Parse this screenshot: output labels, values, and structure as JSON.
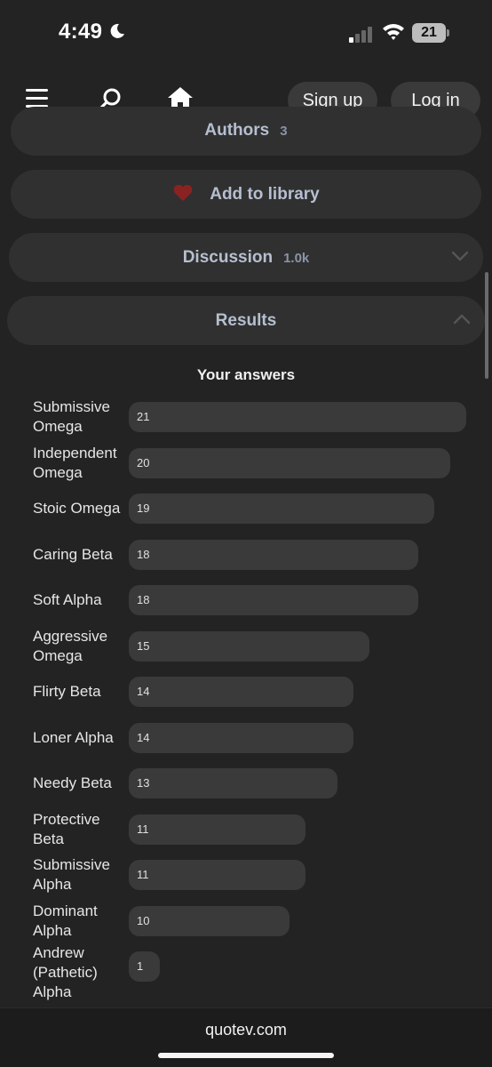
{
  "status_bar": {
    "time": "4:49",
    "battery": "21"
  },
  "nav": {
    "signup_label": "Sign up",
    "login_label": "Log in"
  },
  "sections": {
    "authors": {
      "label": "Authors",
      "count": "3"
    },
    "library": {
      "label": "Add to library"
    },
    "discussion": {
      "label": "Discussion",
      "count": "1.0k"
    },
    "results": {
      "label": "Results"
    }
  },
  "results_heading": "Your answers",
  "answers": [
    {
      "label": "Submissive Omega",
      "value": 21
    },
    {
      "label": "Independent Omega",
      "value": 20
    },
    {
      "label": "Stoic Omega",
      "value": 19
    },
    {
      "label": "Caring Beta",
      "value": 18
    },
    {
      "label": "Soft Alpha",
      "value": 18
    },
    {
      "label": "Aggressive Omega",
      "value": 15
    },
    {
      "label": "Flirty Beta",
      "value": 14
    },
    {
      "label": "Loner Alpha",
      "value": 14
    },
    {
      "label": "Needy Beta",
      "value": 13
    },
    {
      "label": "Protective Beta",
      "value": 11
    },
    {
      "label": "Submissive Alpha",
      "value": 11
    },
    {
      "label": "Dominant Alpha",
      "value": 10
    },
    {
      "label": "Andrew (Pathetic) Alpha",
      "value": 1
    }
  ],
  "footer": {
    "domain": "quotev.com"
  },
  "colors": {
    "background": "#232323",
    "section": "#303030",
    "bar": "#3a3a3a",
    "heart": "#8b2222",
    "section_text": "#b6bfd0"
  }
}
